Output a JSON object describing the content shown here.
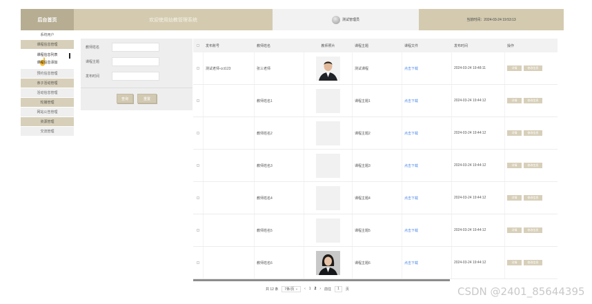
{
  "header": {
    "logo": "后台首页",
    "welcome": "欢迎使用幼教管理系统",
    "admin_name": "测试管理员",
    "clock": "当前时间：2024-03-24 19:53:13"
  },
  "sidebar": {
    "items": [
      {
        "label": "系统用户"
      },
      {
        "label": "课程信息管理"
      }
    ],
    "submenu": [
      {
        "label": "课程信息列表"
      },
      {
        "label": "课程信息添加"
      }
    ],
    "items_after": [
      {
        "label": "预约信息管理"
      },
      {
        "label": "亲子活动管理"
      },
      {
        "label": "活动信息管理"
      },
      {
        "label": "轮播管理"
      },
      {
        "label": "网站公告管理"
      },
      {
        "label": "资源管理"
      },
      {
        "label": "交流管理"
      }
    ]
  },
  "search": {
    "fields": [
      {
        "label": "教师姓名"
      },
      {
        "label": "课程主题"
      },
      {
        "label": "发布时间"
      }
    ],
    "search_label": "查询",
    "reset_label": "重置"
  },
  "table": {
    "columns": [
      "发布账号",
      "教师姓名",
      "教师照片",
      "课程主题",
      "课程文件",
      "发布时间",
      "操作"
    ],
    "rows": [
      {
        "account": "测试老师-cct123",
        "name": "张三老师",
        "photo": "man",
        "topic": "测试课程",
        "file": "点击下载",
        "time": "2024-03-24 19:48:11"
      },
      {
        "account": "",
        "name": "教师姓名1",
        "photo": "blank",
        "topic": "课程主题1",
        "file": "点击下载",
        "time": "2024-03-24 19:44:12"
      },
      {
        "account": "",
        "name": "教师姓名2",
        "photo": "blank",
        "topic": "课程主题2",
        "file": "点击下载",
        "time": "2024-03-24 19:44:12"
      },
      {
        "account": "",
        "name": "教师姓名3",
        "photo": "blank",
        "topic": "课程主题3",
        "file": "点击下载",
        "time": "2024-03-24 19:44:12"
      },
      {
        "account": "",
        "name": "教师姓名4",
        "photo": "blank",
        "topic": "课程主题4",
        "file": "点击下载",
        "time": "2024-03-24 19:44:12"
      },
      {
        "account": "",
        "name": "教师姓名5",
        "photo": "blank",
        "topic": "课程主题5",
        "file": "点击下载",
        "time": "2024-03-24 19:44:12"
      },
      {
        "account": "",
        "name": "教师姓名6",
        "photo": "woman",
        "topic": "课程主题6",
        "file": "点击下载",
        "time": "2024-03-24 19:44:12"
      }
    ],
    "op_edit": "详情",
    "op_delete": "修改信息"
  },
  "pager": {
    "total": "共 12 条",
    "page_size": "7条/页",
    "prev": "‹",
    "page1": "1",
    "page2": "2",
    "next": "›",
    "goto_label": "前往",
    "goto_value": "1",
    "goto_suffix": "页"
  },
  "watermark": "CSDN @2401_85644395"
}
